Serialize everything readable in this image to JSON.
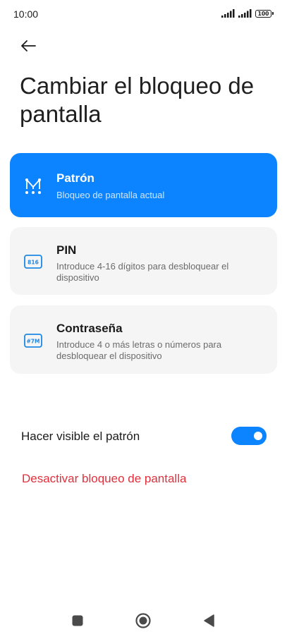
{
  "status_bar": {
    "time": "10:00",
    "battery": "100",
    "icons": [
      "signal-icon",
      "signal-icon",
      "battery-icon"
    ]
  },
  "header": {
    "back_icon": "arrow-left-icon",
    "title": "Cambiar el bloqueo de pantalla"
  },
  "options": [
    {
      "title": "Patrón",
      "description": "Bloqueo de pantalla actual",
      "icon": "pattern-icon",
      "selected": true
    },
    {
      "title": "PIN",
      "description": "Introduce 4-16 dígitos para desbloquear el dispositivo",
      "icon": "pin-icon",
      "icon_text": "816",
      "selected": false
    },
    {
      "title": "Contraseña",
      "description": "Introduce 4 o más letras o números para desbloquear el dispositivo",
      "icon": "password-icon",
      "icon_text": "#7M",
      "selected": false
    }
  ],
  "settings": {
    "visible_pattern_label": "Hacer visible el patrón",
    "visible_pattern_on": true,
    "disable_lock_label": "Desactivar bloqueo de pantalla"
  },
  "nav_bar": {
    "icons": [
      "recents-square-icon",
      "home-circle-icon",
      "back-triangle-icon"
    ]
  },
  "colors": {
    "accent": "#0d84ff",
    "danger": "#e0303c",
    "card_bg": "#f5f5f5"
  }
}
